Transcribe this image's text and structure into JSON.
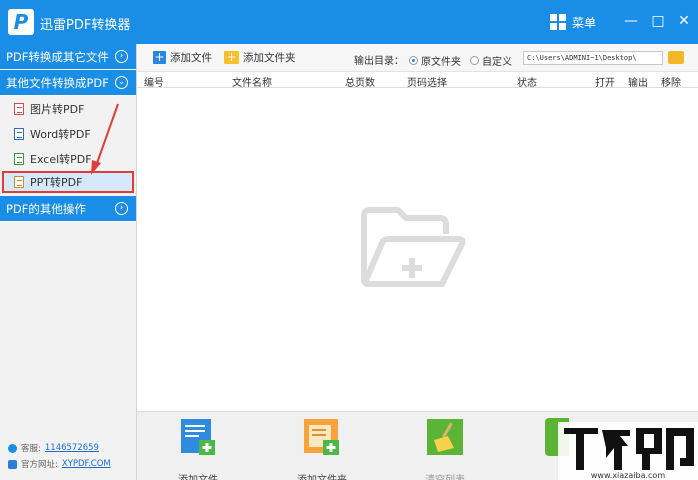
{
  "app": {
    "title": "迅雷PDF转换器",
    "menu_label": "菜单",
    "logo_letter": "P"
  },
  "window_controls": {
    "minimize": "—",
    "maximize": "□",
    "close": "✕"
  },
  "sidebar": {
    "sections": [
      {
        "label": "PDF转换成其它文件",
        "icon": "circle-right-icon"
      },
      {
        "label": "其他文件转换成PDF",
        "icon": "circle-down-icon"
      },
      {
        "label": "PDF的其他操作",
        "icon": "circle-right-icon"
      }
    ],
    "items": [
      {
        "label": "图片转PDF",
        "icon": "image-file-icon"
      },
      {
        "label": "Word转PDF",
        "icon": "word-file-icon"
      },
      {
        "label": "Excel转PDF",
        "icon": "excel-file-icon"
      },
      {
        "label": "PPT转PDF",
        "icon": "ppt-file-icon",
        "selected": true
      }
    ],
    "contact": {
      "qq_label": "客服:",
      "qq_number": "1146572659",
      "site_label": "官方网址:",
      "site_url": "XYPDF.COM"
    }
  },
  "toolbar": {
    "add_file": "添加文件",
    "add_folder": "添加文件夹",
    "output_label": "输出目录：",
    "radio_source": "原文件夹",
    "radio_custom": "自定义",
    "path_value": "C:\\Users\\ADMINI~1\\Desktop\\"
  },
  "table": {
    "columns": [
      "编号",
      "文件名称",
      "总页数",
      "页码选择",
      "状态",
      "打开",
      "输出",
      "移除"
    ]
  },
  "bottom": {
    "add_file": "添加文件",
    "add_folder": "添加文件夹",
    "clear_list": "清空列表"
  },
  "watermark": {
    "site": "www.xiazaiba.com"
  },
  "colors": {
    "accent": "#1a8ee6",
    "highlight_border": "#e23b3b",
    "arrow": "#e23b3b"
  }
}
